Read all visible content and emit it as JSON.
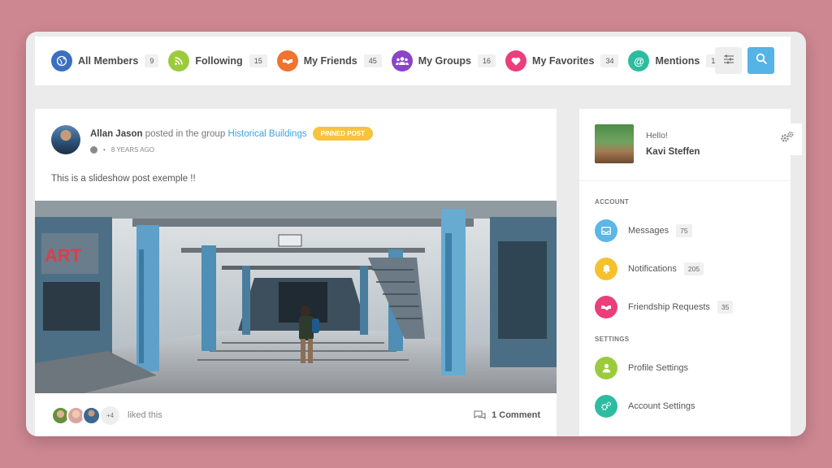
{
  "filters": [
    {
      "label": "All Members",
      "count": "9",
      "color": "#3a6fc2",
      "icon": "globe-icon"
    },
    {
      "label": "Following",
      "count": "15",
      "color": "#9bcb3c",
      "icon": "rss-icon"
    },
    {
      "label": "My Friends",
      "count": "45",
      "color": "#f0732e",
      "icon": "handshake-icon"
    },
    {
      "label": "My Groups",
      "count": "16",
      "color": "#8b44c9",
      "icon": "users-icon"
    },
    {
      "label": "My Favorites",
      "count": "34",
      "color": "#ea3f7a",
      "icon": "heart-icon"
    },
    {
      "label": "Mentions",
      "count": "10",
      "color": "#2dbca0",
      "icon": "at-icon"
    }
  ],
  "post": {
    "author": "Allan Jason",
    "action": "posted in the group",
    "group": "Historical Buildings",
    "badge": "PINNED POST",
    "time": "8 YEARS AGO",
    "text": "This is a slideshow post exemple !!",
    "likes_more": "+4",
    "liked_text": "liked this",
    "comments": "1 Comment"
  },
  "sidebar": {
    "greeting": "Hello!",
    "name": "Kavi Steffen",
    "account_heading": "ACCOUNT",
    "settings_heading": "SETTINGS",
    "account_items": [
      {
        "label": "Messages",
        "count": "75",
        "color": "#5cb6e6",
        "icon": "inbox-icon"
      },
      {
        "label": "Notifications",
        "count": "205",
        "color": "#f6c12f",
        "icon": "bell-icon"
      },
      {
        "label": "Friendship Requests",
        "count": "35",
        "color": "#ea3f7a",
        "icon": "handshake-icon"
      }
    ],
    "settings_items": [
      {
        "label": "Profile Settings",
        "color": "#9bcb3c",
        "icon": "user-icon"
      },
      {
        "label": "Account Settings",
        "color": "#2dbca0",
        "icon": "gears-icon"
      }
    ]
  }
}
